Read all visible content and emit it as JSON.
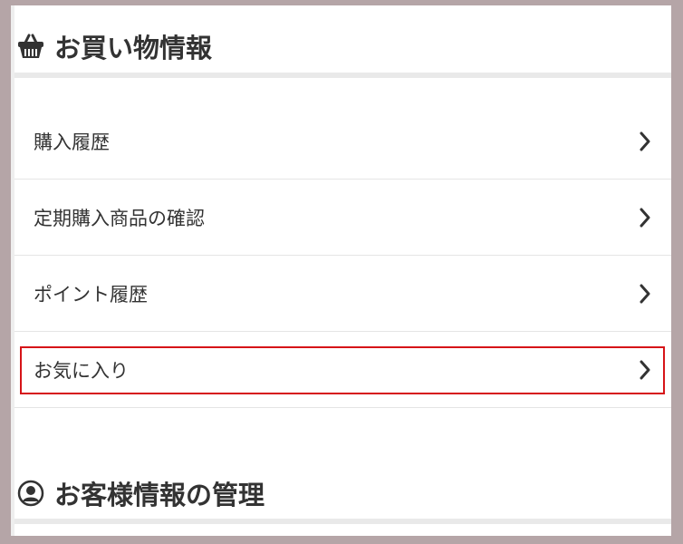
{
  "section_shopping": {
    "title": "お買い物情報",
    "icon": "basket-icon",
    "items": [
      {
        "label": "購入履歴"
      },
      {
        "label": "定期購入商品の確認"
      },
      {
        "label": "ポイント履歴"
      },
      {
        "label": "お気に入り"
      }
    ]
  },
  "section_customer": {
    "title": "お客様情報の管理",
    "icon": "user-circle-icon"
  },
  "colors": {
    "background": "#b5a5a7",
    "highlight": "#d61418",
    "text": "#333333"
  }
}
